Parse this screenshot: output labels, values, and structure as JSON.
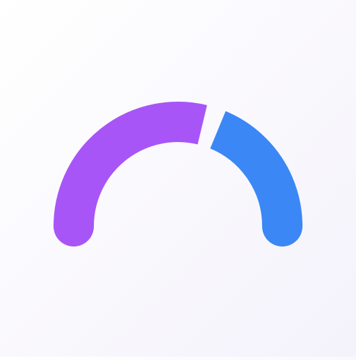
{
  "gauge": {
    "icon": "gauge-icon",
    "segments": [
      {
        "name": "purple-segment",
        "color": "#a855f7",
        "fraction": 0.6
      },
      {
        "name": "blue-segment",
        "color": "#3b87f5",
        "fraction": 0.4
      }
    ]
  },
  "colors": {
    "background": "#f5f3fb"
  }
}
